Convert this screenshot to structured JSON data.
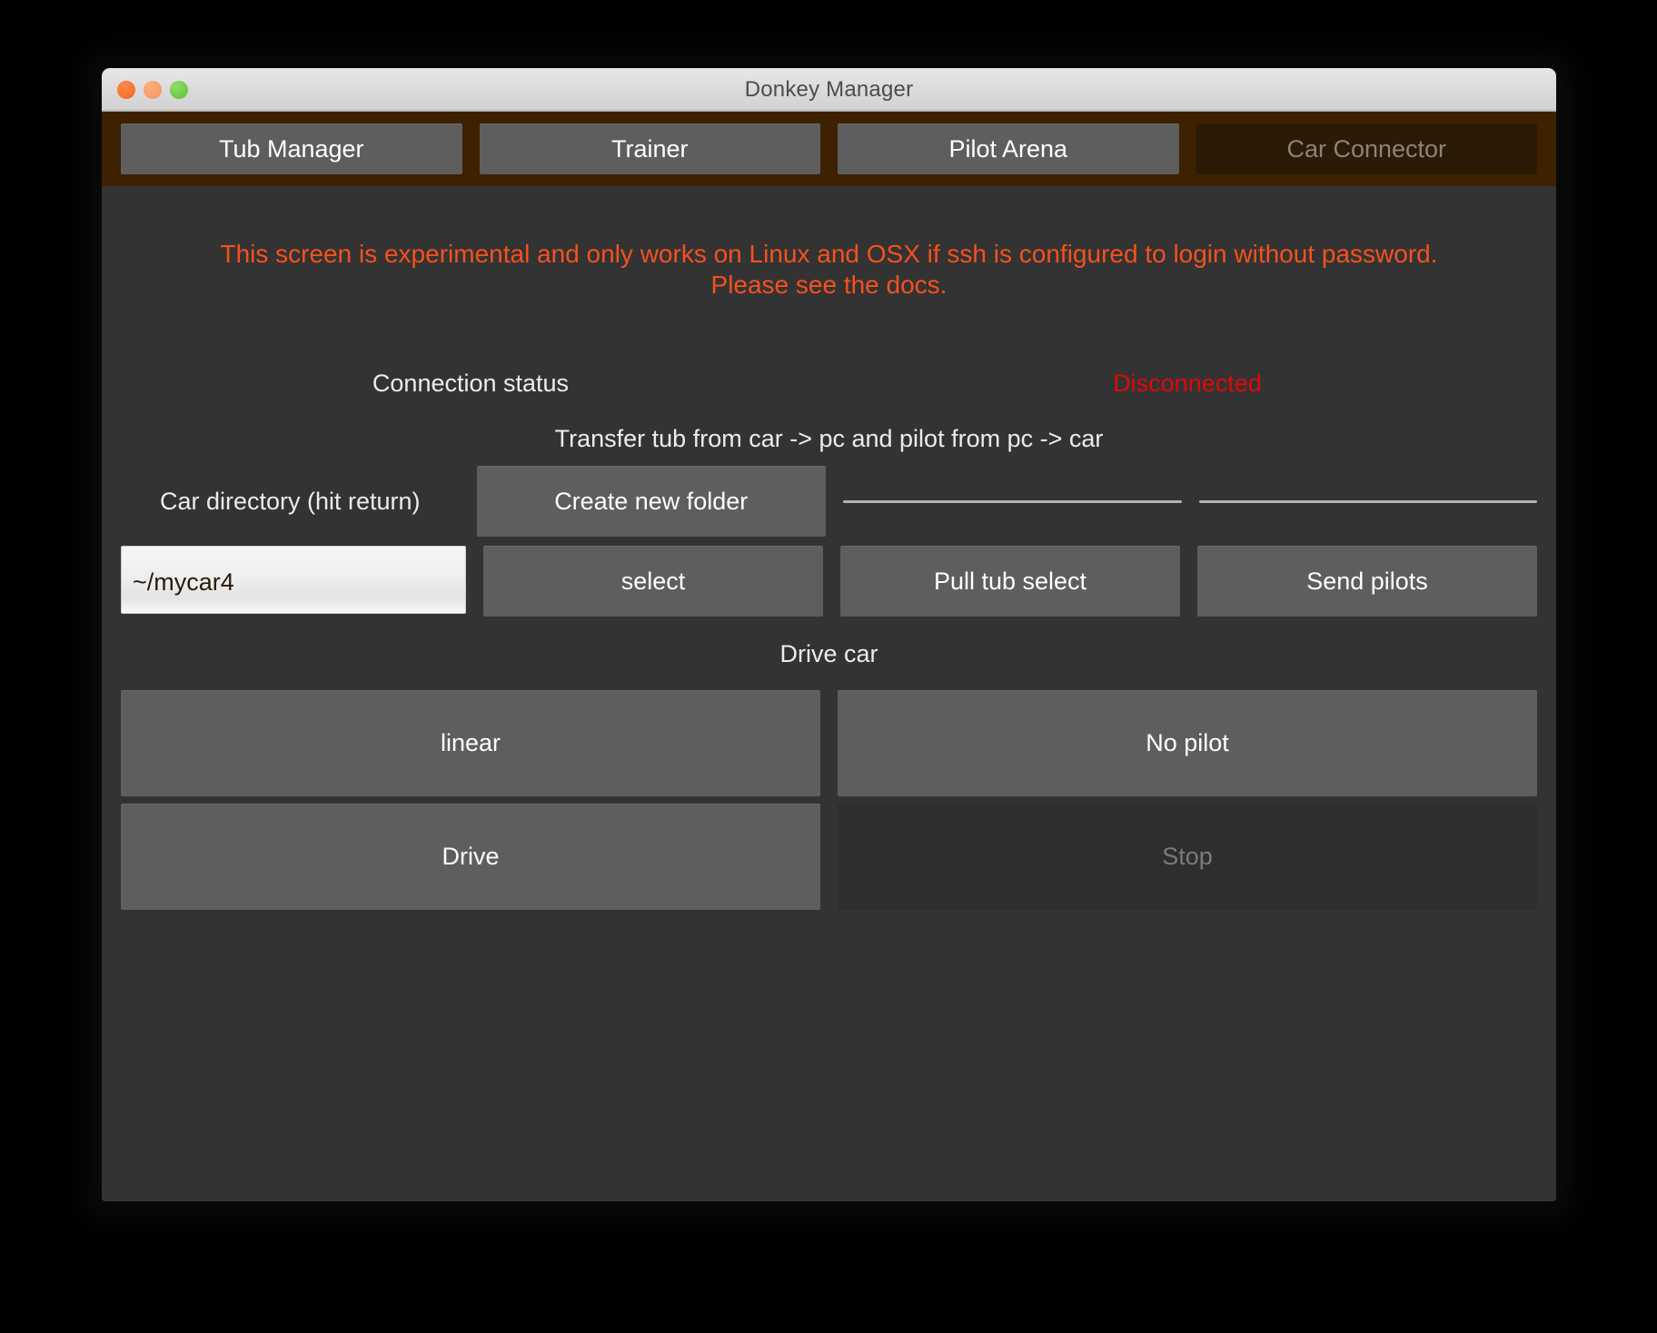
{
  "window": {
    "title": "Donkey Manager",
    "traffic_lights": [
      "close-button",
      "minimize-button",
      "zoom-button"
    ]
  },
  "tabs": [
    {
      "label": "Tub Manager",
      "active": false
    },
    {
      "label": "Trainer",
      "active": false
    },
    {
      "label": "Pilot Arena",
      "active": false
    },
    {
      "label": "Car Connector",
      "active": true
    }
  ],
  "warning": {
    "text": "This screen is experimental and only works on Linux and OSX if ssh is configured to login without password. Please see the docs.",
    "color": "#f4511e"
  },
  "connection": {
    "label": "Connection status",
    "status": "Disconnected",
    "status_color": "#e00808"
  },
  "transfer": {
    "heading": "Transfer tub from car -> pc and pilot from pc -> car"
  },
  "car_directory": {
    "label": "Car directory (hit return)",
    "value": "~/mycar4",
    "placeholder": "~/mycar4"
  },
  "buttons": {
    "create_new_folder": "Create new folder",
    "select": "select",
    "pull_tub_select": "Pull tub select",
    "send_pilots": "Send pilots"
  },
  "drive": {
    "heading": "Drive car",
    "pilot_type": "linear",
    "pilot_choice": "No pilot",
    "drive": "Drive",
    "stop": "Stop",
    "stop_disabled": true
  },
  "colors": {
    "window_body": "#333333",
    "tabbar": "#3d2100",
    "button": "#5e5e5e",
    "active_tab": "#2b1a06",
    "text": "#ececec"
  }
}
